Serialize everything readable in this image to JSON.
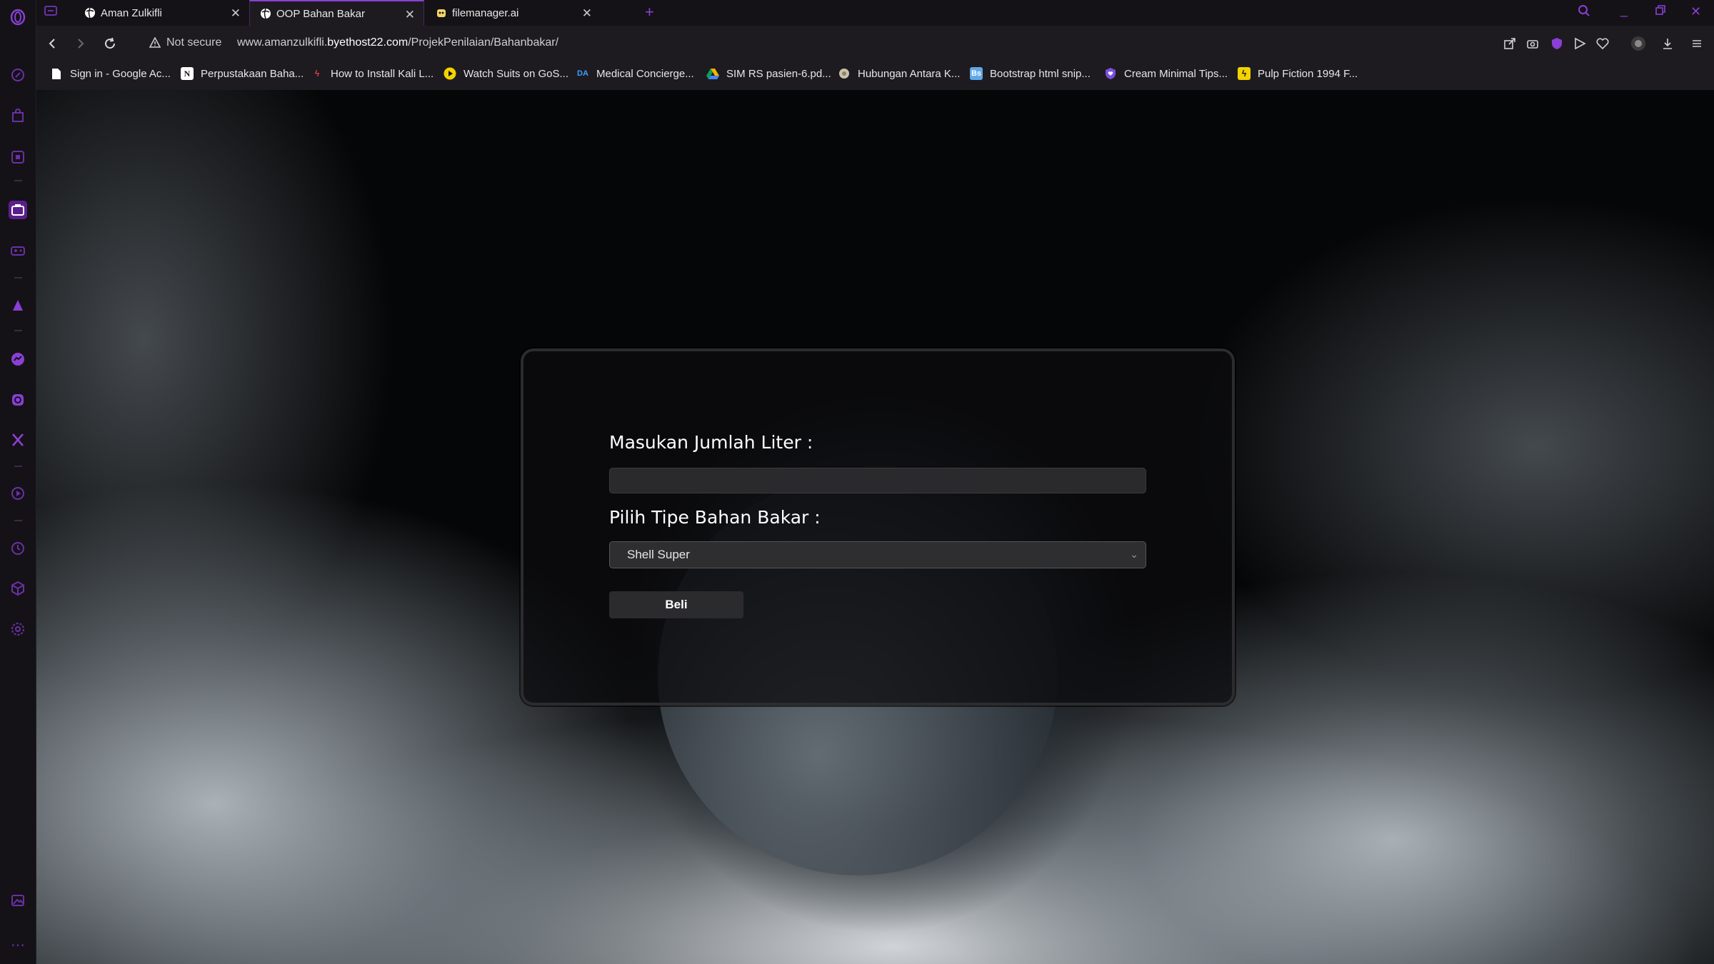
{
  "tabs": [
    {
      "label": "Aman Zulkifli",
      "active": false
    },
    {
      "label": "OOP Bahan Bakar",
      "active": true
    },
    {
      "label": "filemanager.ai",
      "active": false
    }
  ],
  "addressbar": {
    "security_label": "Not secure",
    "url_prefix": "www.amanzulkifli.",
    "url_host": "byethost22.com",
    "url_path": "/ProjekPenilaian/Bahanbakar/"
  },
  "bookmarks": [
    {
      "label": "Sign in - Google Ac...",
      "icon": "document-icon"
    },
    {
      "label": "Perpustakaan Baha...",
      "icon": "notion-icon"
    },
    {
      "label": "How to Install Kali L...",
      "icon": "kali-icon"
    },
    {
      "label": "Watch Suits on GoS...",
      "icon": "play-icon"
    },
    {
      "label": "Medical Concierge...",
      "icon": "da-icon",
      "icon_text": "DA"
    },
    {
      "label": "SIM RS pasien-6.pd...",
      "icon": "drive-icon"
    },
    {
      "label": "Hubungan Antara K...",
      "icon": "globe-icon"
    },
    {
      "label": "Bootstrap html snip...",
      "icon": "bs-icon",
      "icon_text": "Bs"
    },
    {
      "label": "Cream Minimal Tips...",
      "icon": "heart-shield-icon"
    },
    {
      "label": "Pulp Fiction 1994 F...",
      "icon": "bolt-icon"
    }
  ],
  "form": {
    "liter_label": "Masukan Jumlah Liter :",
    "liter_value": "",
    "fuel_label": "Pilih Tipe Bahan Bakar :",
    "fuel_selected": "Shell Super",
    "submit_label": "Beli"
  },
  "colors": {
    "accent": "#8a3fd6",
    "sidebar_bg": "#141216",
    "toolbar_bg": "#1d1b20",
    "card_bg": "#0c0c0e"
  }
}
